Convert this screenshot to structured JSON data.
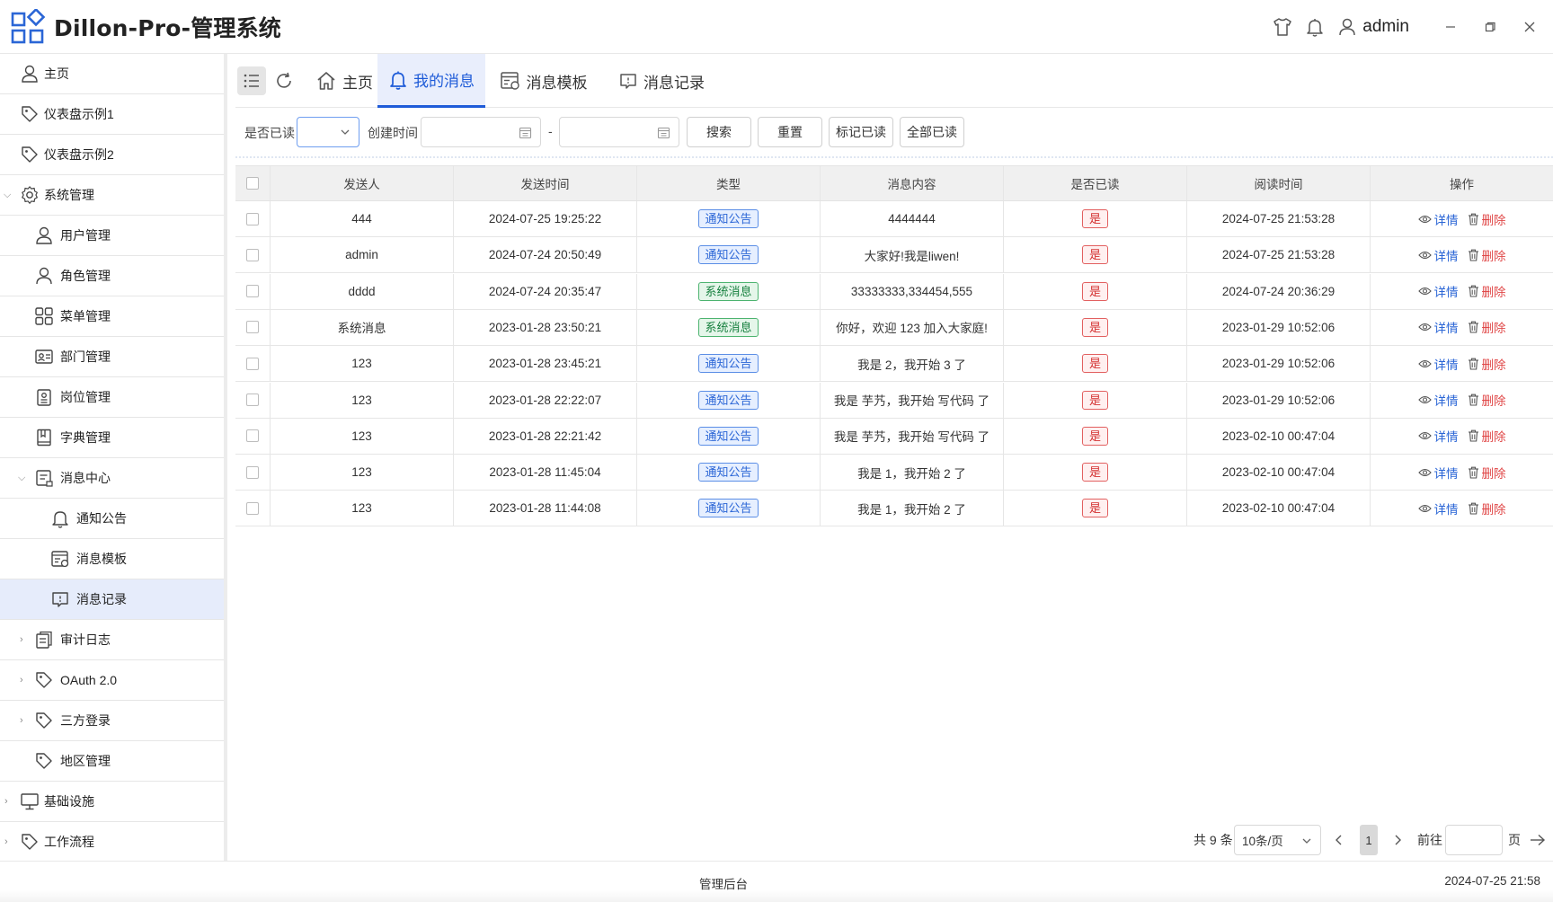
{
  "app": {
    "title": "Dillon-Pro-管理系统",
    "user": "admin"
  },
  "sidebar": {
    "items": [
      {
        "label": "主页"
      },
      {
        "label": "仪表盘示例1"
      },
      {
        "label": "仪表盘示例2"
      },
      {
        "label": "系统管理"
      },
      {
        "label": "用户管理"
      },
      {
        "label": "角色管理"
      },
      {
        "label": "菜单管理"
      },
      {
        "label": "部门管理"
      },
      {
        "label": "岗位管理"
      },
      {
        "label": "字典管理"
      },
      {
        "label": "消息中心"
      },
      {
        "label": "通知公告"
      },
      {
        "label": "消息模板"
      },
      {
        "label": "消息记录"
      },
      {
        "label": "审计日志"
      },
      {
        "label": "OAuth 2.0"
      },
      {
        "label": "三方登录"
      },
      {
        "label": "地区管理"
      },
      {
        "label": "基础设施"
      },
      {
        "label": "工作流程"
      }
    ]
  },
  "tabs": [
    {
      "label": "主页"
    },
    {
      "label": "我的消息"
    },
    {
      "label": "消息模板"
    },
    {
      "label": "消息记录"
    }
  ],
  "filter": {
    "read_label": "是否已读",
    "created_label": "创建时间",
    "range_sep": "-",
    "search": "搜索",
    "reset": "重置",
    "mark_read": "标记已读",
    "all_read": "全部已读"
  },
  "table": {
    "columns": [
      "发送人",
      "发送时间",
      "类型",
      "消息内容",
      "是否已读",
      "阅读时间",
      "操作"
    ],
    "detail": "详情",
    "delete": "删除",
    "rows": [
      {
        "sender": "444",
        "sent": "2024-07-25 19:25:22",
        "type": "通知公告",
        "type_kind": "notice",
        "content": "4444444",
        "read": "是",
        "read_time": "2024-07-25 21:53:28"
      },
      {
        "sender": "admin",
        "sent": "2024-07-24 20:50:49",
        "type": "通知公告",
        "type_kind": "notice",
        "content": "大家好!我是liwen!",
        "read": "是",
        "read_time": "2024-07-25 21:53:28"
      },
      {
        "sender": "dddd",
        "sent": "2024-07-24 20:35:47",
        "type": "系统消息",
        "type_kind": "system",
        "content": "33333333,334454,555",
        "read": "是",
        "read_time": "2024-07-24 20:36:29"
      },
      {
        "sender": "系统消息",
        "sent": "2023-01-28 23:50:21",
        "type": "系统消息",
        "type_kind": "system",
        "content": "你好，欢迎 123 加入大家庭!",
        "read": "是",
        "read_time": "2023-01-29 10:52:06"
      },
      {
        "sender": "123",
        "sent": "2023-01-28 23:45:21",
        "type": "通知公告",
        "type_kind": "notice",
        "content": "我是 2，我开始 3 了",
        "read": "是",
        "read_time": "2023-01-29 10:52:06"
      },
      {
        "sender": "123",
        "sent": "2023-01-28 22:22:07",
        "type": "通知公告",
        "type_kind": "notice",
        "content": "我是 芋艿，我开始 写代码 了",
        "read": "是",
        "read_time": "2023-01-29 10:52:06"
      },
      {
        "sender": "123",
        "sent": "2023-01-28 22:21:42",
        "type": "通知公告",
        "type_kind": "notice",
        "content": "我是 芋艿，我开始 写代码 了",
        "read": "是",
        "read_time": "2023-02-10 00:47:04"
      },
      {
        "sender": "123",
        "sent": "2023-01-28 11:45:04",
        "type": "通知公告",
        "type_kind": "notice",
        "content": "我是 1，我开始 2 了",
        "read": "是",
        "read_time": "2023-02-10 00:47:04"
      },
      {
        "sender": "123",
        "sent": "2023-01-28 11:44:08",
        "type": "通知公告",
        "type_kind": "notice",
        "content": "我是 1，我开始 2 了",
        "read": "是",
        "read_time": "2023-02-10 00:47:04"
      }
    ]
  },
  "pagination": {
    "total": "共 9 条",
    "page_size": "10条/页",
    "current": "1",
    "goto": "前往",
    "page_unit": "页"
  },
  "footer": {
    "center": "管理后台",
    "time": "2024-07-25 21:58"
  },
  "colors": {
    "accent": "#1e5bd8",
    "danger": "#e04848",
    "success": "#17803f"
  }
}
